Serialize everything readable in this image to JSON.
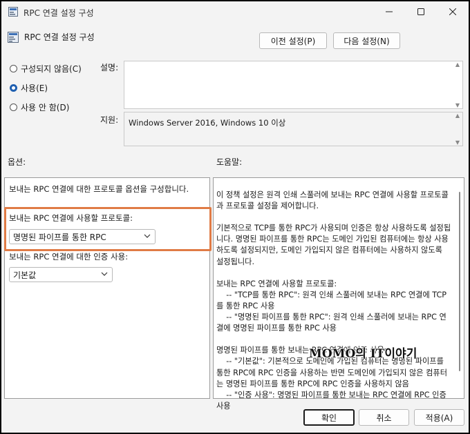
{
  "window": {
    "title": "RPC 연결 설정 구성",
    "header_title": "RPC 연결 설정 구성"
  },
  "nav": {
    "prev_label": "이전 설정(P)",
    "next_label": "다음 설정(N)"
  },
  "state": {
    "options": [
      {
        "label": "구성되지 않음(C)",
        "selected": false
      },
      {
        "label": "사용(E)",
        "selected": true
      },
      {
        "label": "사용 안 함(D)",
        "selected": false
      }
    ]
  },
  "comment": {
    "label": "설명:",
    "value": ""
  },
  "supported": {
    "label": "지원:",
    "value": "Windows Server 2016, Windows 10 이상"
  },
  "options_section": {
    "label": "옵션:",
    "intro": "보내는 RPC 연결에 대한 프로토콜 옵션을 구성합니다.",
    "protocol_label": "보내는 RPC 연결에 사용할 프로토콜:",
    "protocol_value": "명명된 파이프를 통한 RPC",
    "auth_label": "보내는 RPC 연결에 대한 인증 사용:",
    "auth_value": "기본값"
  },
  "help": {
    "label": "도움말:",
    "text": "이 정책 설정은 원격 인쇄 스풀러에 보내는 RPC 연결에 사용할 프로토콜과 프로토콜 설정을 제어합니다.\n\n기본적으로 TCP를 통한 RPC가 사용되며 인증은 항상 사용하도록 설정됩니다. 명명된 파이프를 통한 RPC는 도메인 가입된 컴퓨터에는 항상 사용하도록 설정되지만, 도메인 가입되지 않은 컴퓨터에는 사용하지 않도록 설정됩니다.\n\n보내는 RPC 연결에 사용할 프로토콜:\n    -- \"TCP를 통한 RPC\": 원격 인쇄 스풀러에 보내는 RPC 연결에 TCP를 통한 RPC 사용\n    -- \"명명된 파이프를 통한 RPC\": 원격 인쇄 스풀러에 보내는 RPC 연결에 명명된 파이프를 통한 RPC 사용\n\n명명된 파이프를 통한 보내는 RPC 연결에 인증 사용:\n    -- \"기본값\": 기본적으로 도메인에 가입된 컴퓨터는 명명된 파이프를 통한 RPC에 RPC 인증을 사용하는 반면 도메인에 가입되지 않은 컴퓨터는 명명된 파이프를 통한 RPC에 RPC 인증을 사용하지 않음\n    -- \"인증 사용\": 명명된 파이프를 통한 보내는 RPC 연결에 RPC 인증 사용"
  },
  "footer": {
    "ok_label": "확인",
    "cancel_label": "취소",
    "apply_label": "적용(A)"
  },
  "watermark": "MOMO의 IT이야기",
  "colors": {
    "accent": "#1f5fb0",
    "highlight": "#e07b45"
  }
}
